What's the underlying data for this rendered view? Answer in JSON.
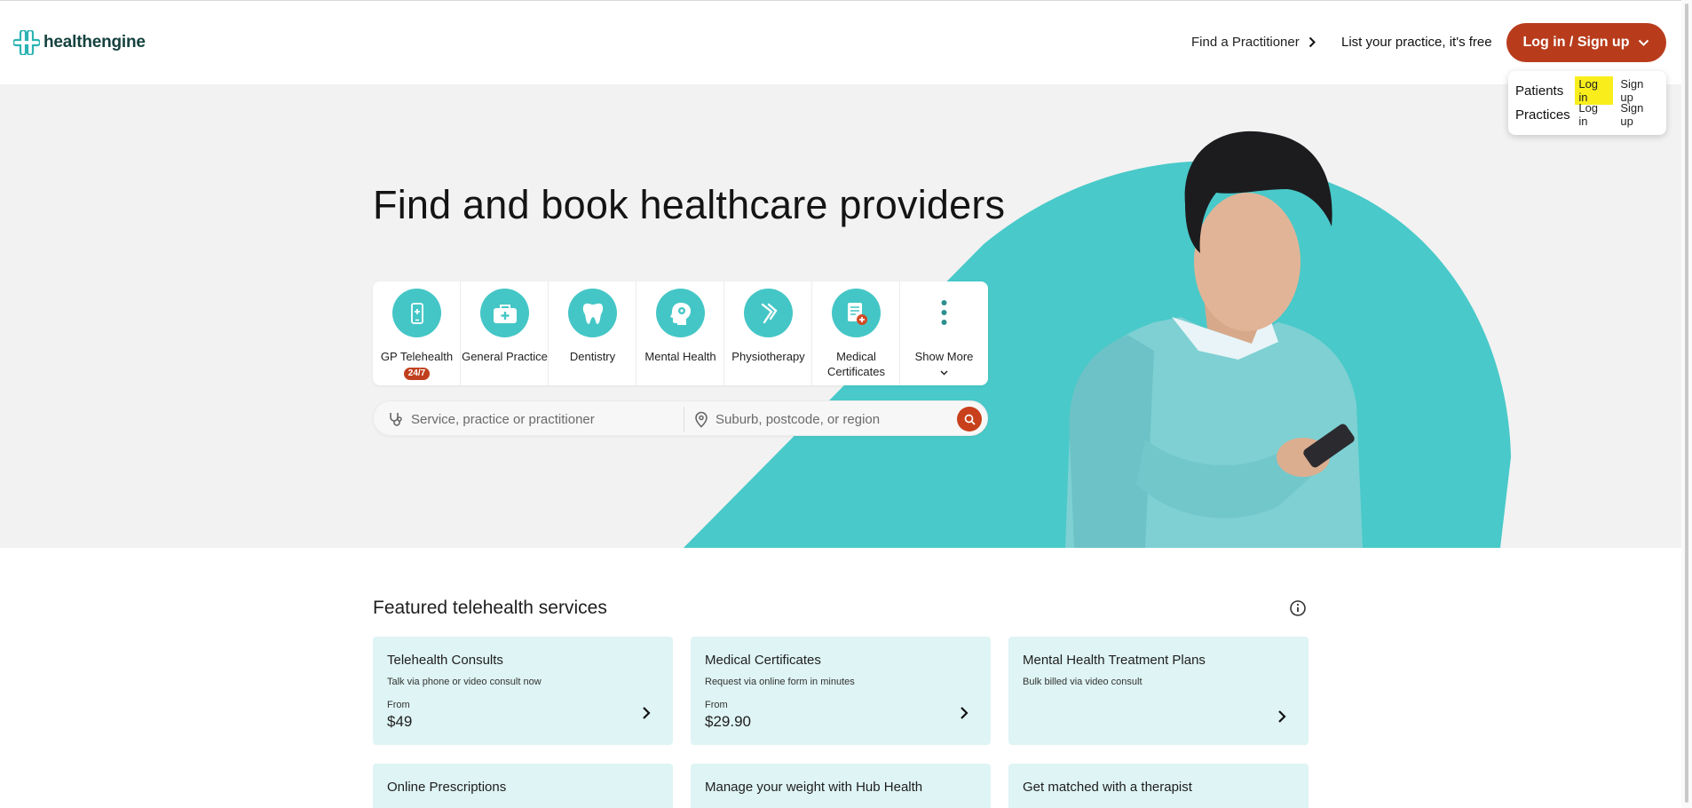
{
  "header": {
    "logo_text": "healthengine",
    "find_practitioner": "Find a Practitioner",
    "list_practice": "List your practice, it's free",
    "login_button": "Log in / Sign up"
  },
  "dropdown": {
    "patients_label": "Patients",
    "practices_label": "Practices",
    "patients_login": "Log in",
    "patients_signup": "Sign up",
    "practices_login": "Log in",
    "practices_signup": "Sign up"
  },
  "hero": {
    "title": "Find and book healthcare providers",
    "categories": [
      {
        "label": "GP Telehealth",
        "badge": "24/7",
        "icon": "phone-plus-icon"
      },
      {
        "label": "General Practice",
        "icon": "medical-bag-icon"
      },
      {
        "label": "Dentistry",
        "icon": "tooth-icon"
      },
      {
        "label": "Mental Health",
        "icon": "head-icon"
      },
      {
        "label": "Physiotherapy",
        "icon": "physio-icon"
      },
      {
        "label": "Medical Certificates",
        "icon": "certificate-icon"
      },
      {
        "label": "Show More",
        "icon": "more-dots-icon"
      }
    ],
    "search_service_placeholder": "Service, practice or practitioner",
    "search_location_placeholder": "Suburb, postcode, or region"
  },
  "featured": {
    "title": "Featured telehealth services",
    "cards": [
      {
        "title": "Telehealth Consults",
        "subtitle": "Talk via phone or video consult now",
        "from": "From",
        "price": "$49"
      },
      {
        "title": "Medical Certificates",
        "subtitle": "Request via online form in minutes",
        "from": "From",
        "price": "$29.90"
      },
      {
        "title": "Mental Health Treatment Plans",
        "subtitle": "Bulk billed via video consult",
        "from": "",
        "price": ""
      },
      {
        "title": "Online Prescriptions"
      },
      {
        "title": "Manage your weight with Hub Health"
      },
      {
        "title": "Get matched with a therapist"
      }
    ]
  },
  "colors": {
    "brand_teal": "#45c6c6",
    "brand_orange": "#b83c1c",
    "card_bg": "#dff4f4",
    "hero_bg": "#f2f2f2"
  }
}
